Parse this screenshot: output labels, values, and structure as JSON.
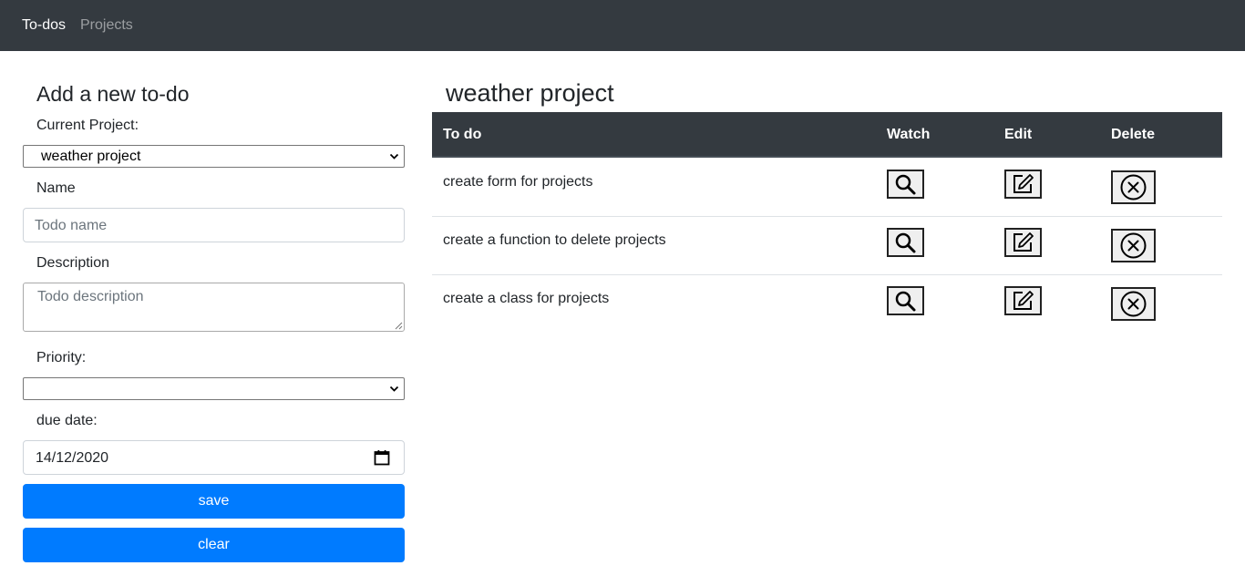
{
  "nav": {
    "todos": "To-dos",
    "projects": "Projects"
  },
  "form": {
    "title": "Add a new to-do",
    "current_project_label": "Current Project:",
    "current_project_value": "weather project",
    "name_label": "Name",
    "name_placeholder": "Todo name",
    "description_label": "Description",
    "description_placeholder": "Todo description",
    "priority_label": "Priority:",
    "priority_value": "",
    "due_date_label": "due date:",
    "due_date_value": "14/12/2020",
    "save_label": "save",
    "clear_label": "clear"
  },
  "project": {
    "title": "weather project",
    "columns": [
      "To do",
      "Watch",
      "Edit",
      "Delete"
    ],
    "rows": [
      {
        "todo": "create form for projects"
      },
      {
        "todo": "create a function to delete projects"
      },
      {
        "todo": "create a class for projects"
      }
    ]
  },
  "icons": {
    "watch": "search-icon",
    "edit": "edit-icon",
    "delete": "x-circle-icon",
    "select": "chevron-down-icon",
    "date": "calendar-icon"
  },
  "colors": {
    "navbar": "#343a40",
    "primary": "#007bff",
    "table_header": "#343a40"
  }
}
